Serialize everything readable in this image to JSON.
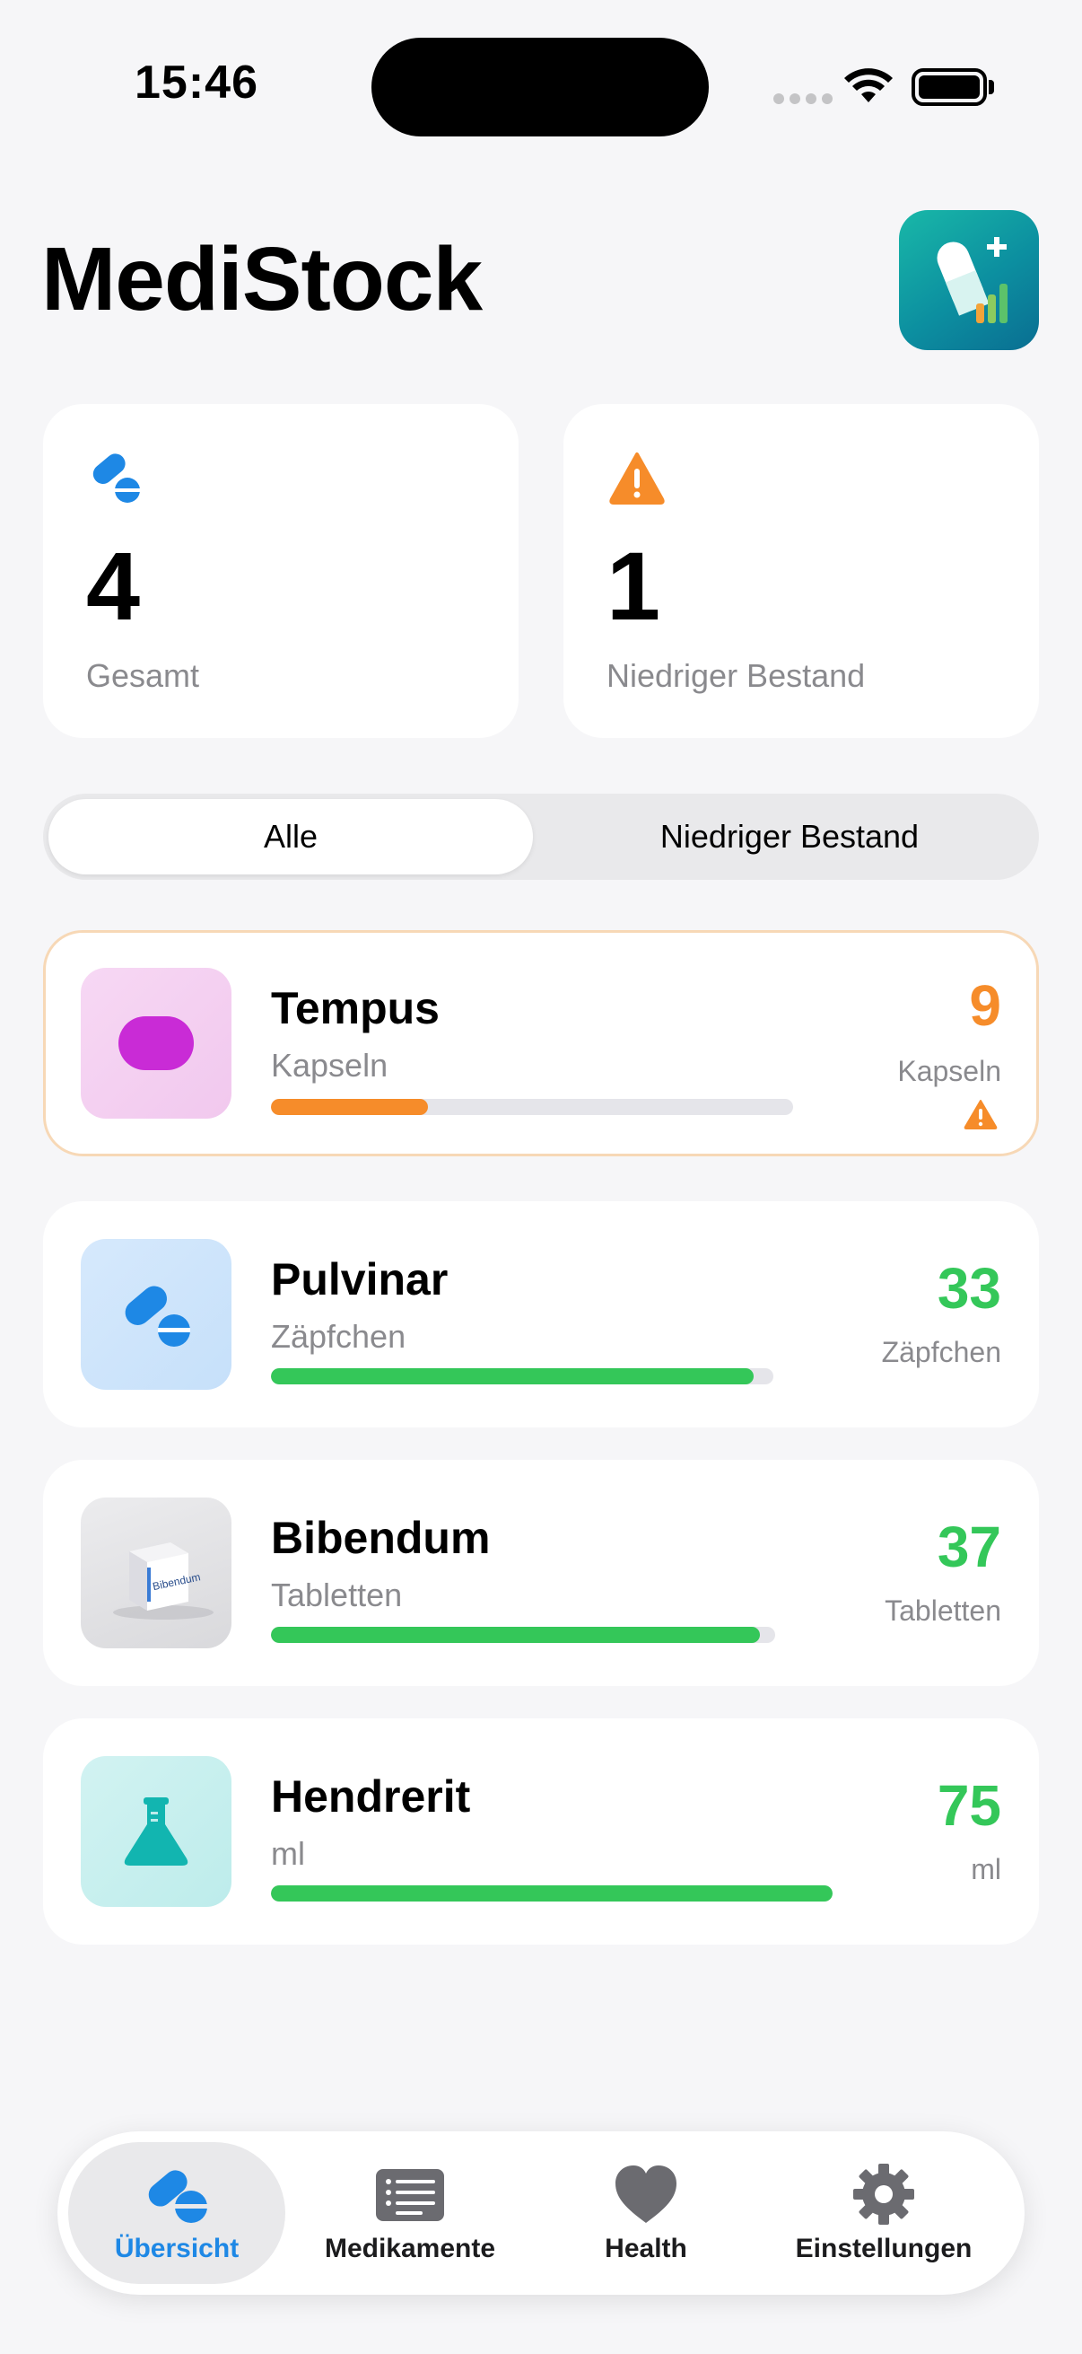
{
  "status_bar": {
    "time": "15:46"
  },
  "header": {
    "title": "MediStock",
    "logo_icon": "app-logo-icon"
  },
  "stats": [
    {
      "icon": "pills-icon",
      "value": "4",
      "label": "Gesamt",
      "color": "#1E88E5"
    },
    {
      "icon": "warning-icon",
      "value": "1",
      "label": "Niedriger Bestand",
      "color": "#F68C2A"
    }
  ],
  "filter": {
    "options": [
      "Alle",
      "Niedriger Bestand"
    ],
    "selected": "Alle"
  },
  "medications": [
    {
      "name": "Tempus",
      "unit": "Kapseln",
      "count": "9",
      "count_unit": "Kapseln",
      "level": 0.3,
      "status": "low",
      "icon": "capsule-icon",
      "color": "#F68C2A"
    },
    {
      "name": "Pulvinar",
      "unit": "Zäpfchen",
      "count": "33",
      "count_unit": "Zäpfchen",
      "level": 0.96,
      "status": "ok",
      "icon": "pills-icon",
      "color": "#34C759"
    },
    {
      "name": "Bibendum",
      "unit": "Tabletten",
      "count": "37",
      "count_unit": "Tabletten",
      "level": 0.97,
      "status": "ok",
      "icon": "medicine-box-photo",
      "box_text": "Bibendum",
      "color": "#34C759"
    },
    {
      "name": "Hendrerit",
      "unit": "ml",
      "count": "75",
      "count_unit": "ml",
      "level": 1.0,
      "status": "ok",
      "icon": "flask-icon",
      "color": "#34C759"
    }
  ],
  "tabbar": {
    "items": [
      {
        "label": "Übersicht",
        "icon": "pills-icon",
        "active": true
      },
      {
        "label": "Medikamente",
        "icon": "list-icon",
        "active": false
      },
      {
        "label": "Health",
        "icon": "heart-icon",
        "active": false
      },
      {
        "label": "Einstellungen",
        "icon": "gear-icon",
        "active": false
      }
    ]
  },
  "colors": {
    "accent": "#1E88E5",
    "warning": "#F68C2A",
    "ok": "#34C759",
    "background": "#F6F6F8"
  }
}
